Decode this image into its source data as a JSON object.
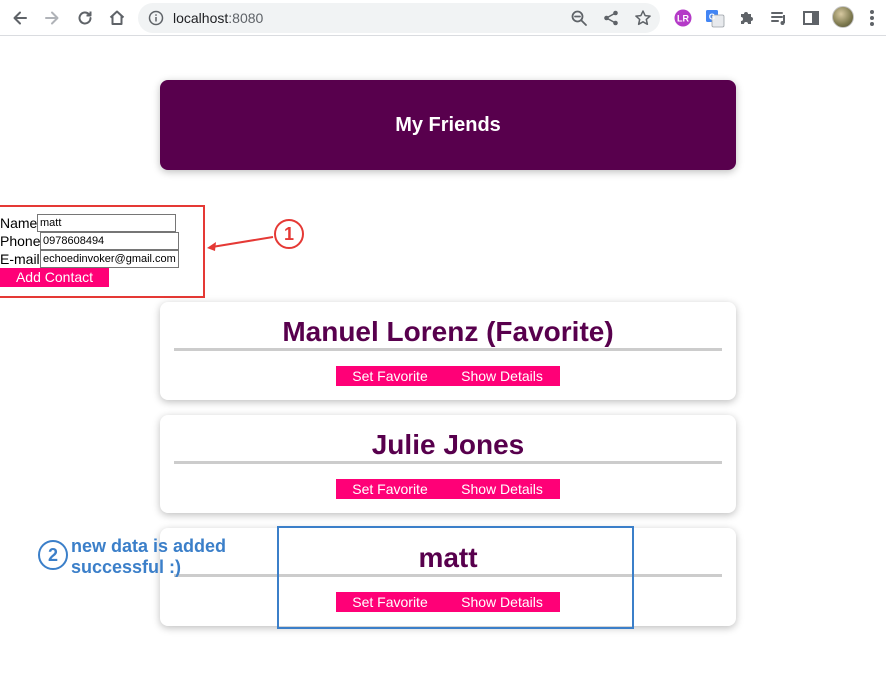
{
  "browser": {
    "url_host": "localhost",
    "url_port": ":8080",
    "icons": [
      "back-icon",
      "forward-icon",
      "reload-icon",
      "home-icon",
      "info-icon",
      "zoom-icon",
      "share-icon",
      "bookmark-star-icon",
      "extension-lr-icon",
      "google-translate-icon",
      "puzzle-extensions-icon",
      "media-queue-icon",
      "side-panel-icon",
      "profile-avatar",
      "menu-dots-icon"
    ]
  },
  "app": {
    "title": "My Friends"
  },
  "form": {
    "name_label": "Name",
    "name_value": "matt",
    "phone_label": "Phone",
    "phone_value": "0978608494",
    "email_label": "E-mail",
    "email_value": "echoedinvoker@gmail.com",
    "submit_label": "Add Contact"
  },
  "friends": [
    {
      "name": "Manuel Lorenz (Favorite)",
      "fav_label": "Set Favorite",
      "details_label": "Show Details"
    },
    {
      "name": "Julie Jones",
      "fav_label": "Set Favorite",
      "details_label": "Show Details"
    },
    {
      "name": "matt",
      "fav_label": "Set Favorite",
      "details_label": "Show Details"
    }
  ],
  "annotations": {
    "step1": "1",
    "step2": "2",
    "step2_text": "new data is added successful :)",
    "red": "#e53935",
    "blue": "#3b7fc9"
  },
  "colors": {
    "header_bg": "#58004d",
    "button_bg": "#ff0077",
    "card_title": "#58004d"
  }
}
